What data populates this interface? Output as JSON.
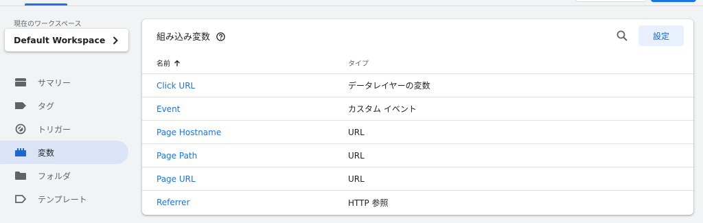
{
  "workspace": {
    "label": "現在のワークスペース",
    "name": "Default Workspace"
  },
  "nav": {
    "items": [
      {
        "label": "サマリー",
        "icon": "summary-icon"
      },
      {
        "label": "タグ",
        "icon": "tag-icon"
      },
      {
        "label": "トリガー",
        "icon": "trigger-icon"
      },
      {
        "label": "変数",
        "icon": "variables-icon",
        "active": true
      },
      {
        "label": "フォルダ",
        "icon": "folder-icon"
      },
      {
        "label": "テンプレート",
        "icon": "template-icon"
      }
    ]
  },
  "main": {
    "title": "組み込み変数",
    "settings_label": "設定",
    "columns": {
      "name": "名前",
      "type": "タイプ"
    },
    "rows": [
      {
        "name": "Click URL",
        "type": "データレイヤーの変数"
      },
      {
        "name": "Event",
        "type": "カスタム イベント"
      },
      {
        "name": "Page Hostname",
        "type": "URL"
      },
      {
        "name": "Page Path",
        "type": "URL"
      },
      {
        "name": "Page URL",
        "type": "URL"
      },
      {
        "name": "Referrer",
        "type": "HTTP 参照"
      }
    ]
  },
  "colors": {
    "accent": "#1a73e8",
    "active_nav_bg": "#dbe4f7",
    "settings_button_bg": "#e8f0fe",
    "page_bg": "#f1f3f4"
  }
}
